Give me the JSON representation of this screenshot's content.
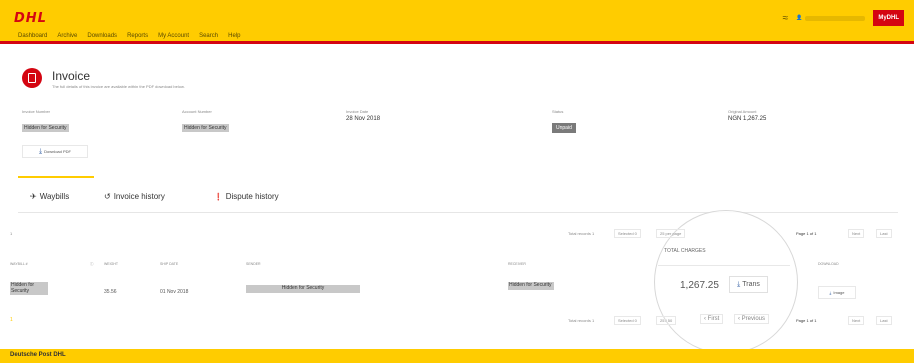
{
  "header": {
    "logo": "DHL",
    "nav": [
      "Dashboard",
      "Archive",
      "Downloads",
      "Reports",
      "My Account",
      "Search",
      "Help"
    ],
    "signal_icon": "signal-icon",
    "user_email": "",
    "mydhl_label": "MyDHL",
    "colors": {
      "yellow": "#ffcc00",
      "red": "#d40511"
    }
  },
  "invoice": {
    "title": "Invoice",
    "subtitle": "The full details of this invoice are available within the PDF download below.",
    "fields": [
      {
        "label": "Invoice Number",
        "value": "Hidden for Security",
        "type": "hidden"
      },
      {
        "label": "Account Number",
        "value": "Hidden for Security",
        "type": "hidden"
      },
      {
        "label": "Invoice Date",
        "value": "28 Nov 2018",
        "type": "text"
      },
      {
        "label": "Status",
        "value": "Unpaid",
        "type": "badge"
      },
      {
        "label": "Original Amount",
        "value": "NGN 1,267.25",
        "type": "text"
      }
    ],
    "download_pdf_label": "Download PDF"
  },
  "tabs": [
    {
      "label": "Waybills",
      "icon": "plane-icon",
      "active": true
    },
    {
      "label": "Invoice history",
      "icon": "history-icon",
      "active": false
    },
    {
      "label": "Dispute history",
      "icon": "exclamation-icon",
      "active": false
    }
  ],
  "pager_top": {
    "count": "1",
    "total_records": "Total records 1",
    "selected": "Selected 0",
    "per_page": "25 per page",
    "page_info": "Page 1 of 1",
    "next": "Next",
    "last": "Last"
  },
  "table": {
    "columns": [
      "WAYBILL #",
      "WEIGHT",
      "SHIP DATE",
      "SENDER",
      "RECEIVER",
      "TOTAL CHARGES",
      "DOWNLOAD"
    ],
    "rows": [
      {
        "waybill": "Hidden for Security",
        "weight": "35.56",
        "ship_date": "01 Nov 2018",
        "sender": "Hidden for Security",
        "receiver": "Hidden for Security",
        "total_charges": "1,267.25",
        "trans_label": "Trans",
        "image_label": "Image"
      }
    ]
  },
  "pager_bottom": {
    "count": "1",
    "total_records": "Total records 1",
    "selected": "Selected 0",
    "per_page": "25 / 50",
    "first": "First",
    "previous": "Previous",
    "page_info": "Page 1 of 1",
    "next": "Next",
    "last": "Last"
  },
  "footer": {
    "label": "Deutsche Post DHL"
  }
}
